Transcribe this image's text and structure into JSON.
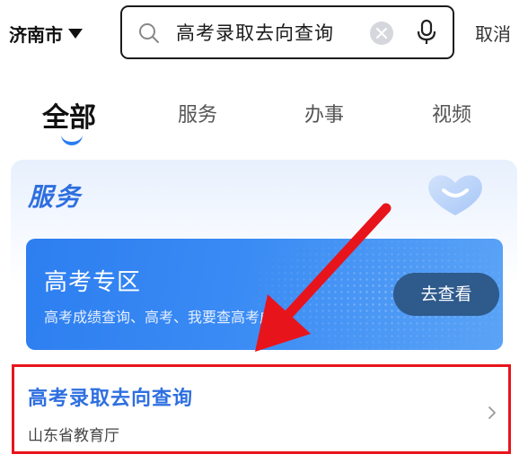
{
  "header": {
    "city": "济南市",
    "search": {
      "value": "高考录取去向查询"
    },
    "cancel_label": "取消"
  },
  "tabs": [
    {
      "label": "全部",
      "active": true
    },
    {
      "label": "服务",
      "active": false
    },
    {
      "label": "办事",
      "active": false
    },
    {
      "label": "视频",
      "active": false
    }
  ],
  "service_section": {
    "title": "服务",
    "banner": {
      "title": "高考专区",
      "subtitle": "高考成绩查询、高考、我要查高考成...",
      "button_label": "去查看"
    },
    "result": {
      "title": "高考录取去向查询",
      "source": "山东省教育厅"
    }
  },
  "colors": {
    "accent": "#2e6fe0",
    "banner": "#2d7ef0",
    "annotation": "#e8141c"
  },
  "icons": [
    "search-icon",
    "clear-icon",
    "microphone-icon",
    "dropdown-caret-icon",
    "heart-logo-icon",
    "chevron-right-icon",
    "annotation-arrow"
  ]
}
